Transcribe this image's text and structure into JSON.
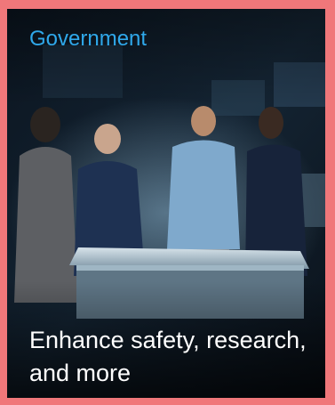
{
  "card": {
    "category": "Government",
    "headline": "Enhance safety, research, and more",
    "image_alt": "Team of four professionals gathered around an illuminated table in a dark control room"
  },
  "colors": {
    "frame": "#f0777a",
    "category_text": "#2fa8ea",
    "headline_text": "#ffffff",
    "background": "#0f1c28"
  }
}
